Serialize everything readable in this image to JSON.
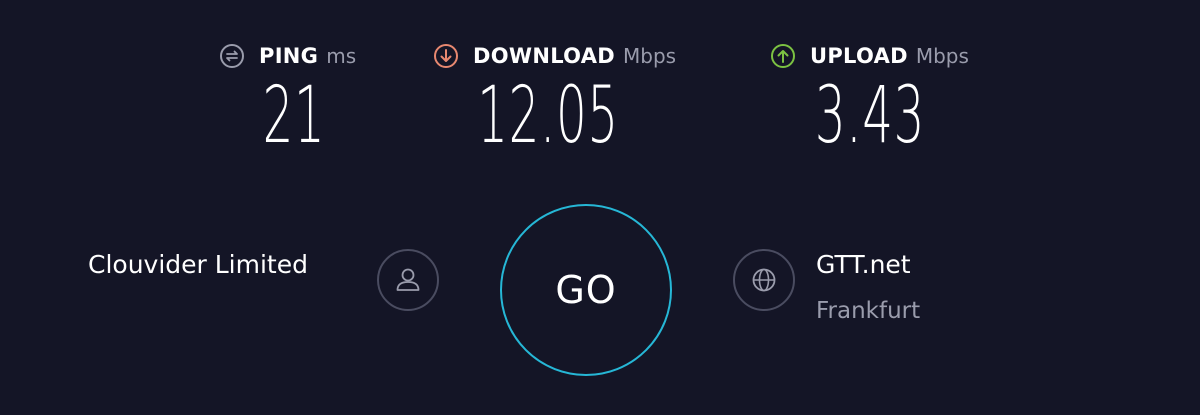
{
  "metrics": {
    "ping": {
      "label": "PING",
      "unit": "ms",
      "value": "21",
      "icon": "ping-icon",
      "icon_color": "#9a9cac"
    },
    "download": {
      "label": "DOWNLOAD",
      "unit": "Mbps",
      "value": "12.05",
      "icon": "download-arrow-icon",
      "icon_color": "#e88870"
    },
    "upload": {
      "label": "UPLOAD",
      "unit": "Mbps",
      "value": "3.43",
      "icon": "upload-arrow-icon",
      "icon_color": "#7cc242"
    }
  },
  "isp": {
    "name": "Clouvider Limited",
    "icon": "user-icon"
  },
  "go_button": {
    "label": "GO",
    "ring_color": "#26b7d6"
  },
  "server": {
    "name": "GTT.net",
    "location": "Frankfurt",
    "icon": "globe-icon"
  },
  "theme": {
    "background": "#141526",
    "text": "#ffffff",
    "muted": "#9a9cac"
  }
}
